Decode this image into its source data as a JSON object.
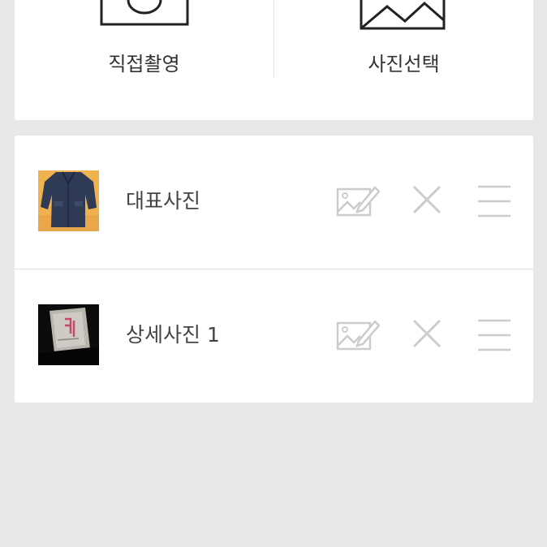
{
  "sources": {
    "camera_label": "직접촬영",
    "gallery_label": "사진선택"
  },
  "photos": [
    {
      "label": "대표사진",
      "thumb": "jacket-photo"
    },
    {
      "label": "상세사진 1",
      "thumb": "tag-photo"
    }
  ],
  "icons": {
    "camera": "camera-icon",
    "gallery": "image-icon",
    "edit": "image-edit-icon",
    "delete": "close-icon",
    "drag": "drag-handle-icon"
  },
  "colors": {
    "background": "#e8e8e8",
    "card": "#ffffff",
    "icon_dark": "#222222",
    "icon_light": "#cccccc",
    "text": "#444444"
  }
}
